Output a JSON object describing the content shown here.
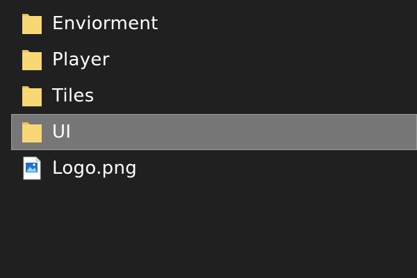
{
  "explorer": {
    "items": [
      {
        "label": "Enviorment",
        "type": "folder",
        "icon": "folder-icon",
        "selected": false
      },
      {
        "label": "Player",
        "type": "folder",
        "icon": "folder-icon",
        "selected": false
      },
      {
        "label": "Tiles",
        "type": "folder",
        "icon": "folder-icon",
        "selected": false
      },
      {
        "label": "UI",
        "type": "folder",
        "icon": "folder-icon",
        "selected": true
      },
      {
        "label": "Logo.png",
        "type": "image-file",
        "icon": "png-file-icon",
        "selected": false
      }
    ]
  },
  "colors": {
    "background": "#202020",
    "selection": "#777777",
    "folder": "#F8D775",
    "text": "#FFFFFF"
  }
}
